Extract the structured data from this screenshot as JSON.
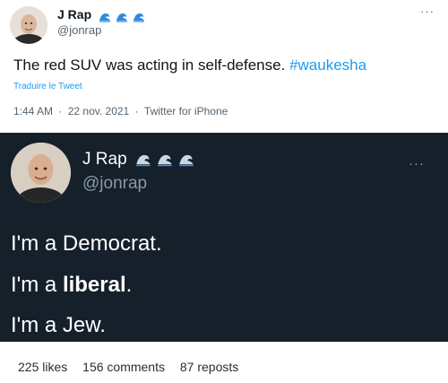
{
  "top_tweet": {
    "display_name": "J Rap",
    "handle": "@jonrap",
    "more": "···",
    "text_main": "The red SUV was acting in self-defense.",
    "hashtag": "#waukesha",
    "translate": "Traduire le Tweet",
    "time": "1:44 AM",
    "separator": "·",
    "date": "22 nov. 2021",
    "source": "Twitter for iPhone",
    "name_icons": [
      "wave-icon",
      "wave-icon",
      "wave-icon"
    ],
    "colors": {
      "link": "#1d9bf0",
      "muted": "#536471"
    }
  },
  "screenshot_tweet": {
    "display_name": "J Rap",
    "handle": "@jonrap",
    "more": "···",
    "name_icons": [
      "wave-icon",
      "wave-icon",
      "wave-icon"
    ],
    "line1": "I'm a Democrat.",
    "line2_prefix": "I'm a ",
    "line2_bold": "liberal",
    "line2_suffix": ".",
    "line3": "I'm a Jew.",
    "colors": {
      "background": "#15202b",
      "muted": "#8899a6"
    }
  },
  "stats": {
    "likes": "225 likes",
    "comments": "156 comments",
    "reposts": "87 reposts"
  }
}
